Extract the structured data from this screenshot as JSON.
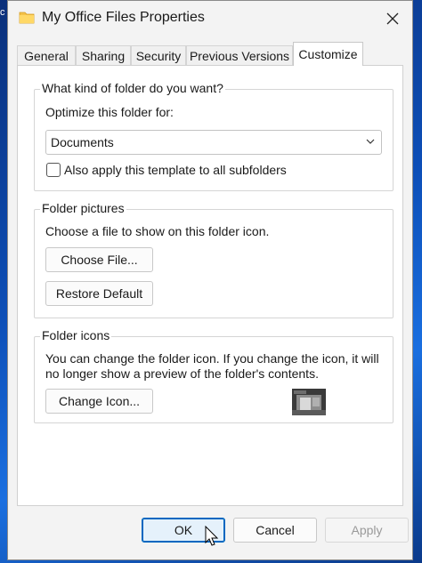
{
  "window": {
    "title": "My Office Files Properties",
    "edge_glyph": "c"
  },
  "tabs": [
    {
      "label": "General"
    },
    {
      "label": "Sharing"
    },
    {
      "label": "Security"
    },
    {
      "label": "Previous Versions"
    },
    {
      "label": "Customize",
      "active": true
    }
  ],
  "folder_type": {
    "group_label": "What kind of folder do you want?",
    "optimize_label": "Optimize this folder for:",
    "selected": "Documents",
    "apply_subfolders_label": "Also apply this template to all subfolders",
    "apply_subfolders_checked": false
  },
  "folder_pictures": {
    "group_label": "Folder pictures",
    "description": "Choose a file to show on this folder icon.",
    "choose_file_button": "Choose File...",
    "restore_default_button": "Restore Default"
  },
  "folder_icons": {
    "group_label": "Folder icons",
    "description": "You can change the folder icon. If you change the icon, it will no longer show a preview of the folder's contents.",
    "change_icon_button": "Change Icon..."
  },
  "footer": {
    "ok_button": "OK",
    "cancel_button": "Cancel",
    "apply_button": "Apply"
  },
  "colors": {
    "accent": "#0067c0",
    "folder_yellow": "#f4c24a"
  },
  "icons": [
    "folder-icon",
    "close-icon",
    "chevron-down-icon",
    "folder-preview-icon",
    "mouse-cursor-icon"
  ]
}
